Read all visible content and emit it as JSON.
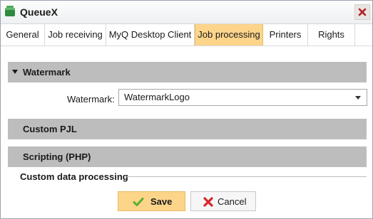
{
  "window": {
    "title": "QueueX"
  },
  "tabs": [
    {
      "label": "General",
      "active": false
    },
    {
      "label": "Job receiving",
      "active": false
    },
    {
      "label": "MyQ Desktop Client",
      "active": false
    },
    {
      "label": "Job processing",
      "active": true
    },
    {
      "label": "Printers",
      "active": false
    },
    {
      "label": "Rights",
      "active": false
    }
  ],
  "sections": {
    "watermark": {
      "title": "Watermark",
      "expanded": true,
      "field_label": "Watermark:",
      "selected_value": "WatermarkLogo"
    },
    "custom_pjl": {
      "title": "Custom PJL"
    },
    "scripting": {
      "title": "Scripting (PHP)"
    },
    "custom_data_processing": {
      "title": "Custom data processing"
    }
  },
  "buttons": {
    "save": "Save",
    "cancel": "Cancel"
  },
  "colors": {
    "accent": "#fcd48a",
    "section_header": "#bdbdbd",
    "save_icon": "#58b22e",
    "cancel_icon": "#d6262b"
  }
}
